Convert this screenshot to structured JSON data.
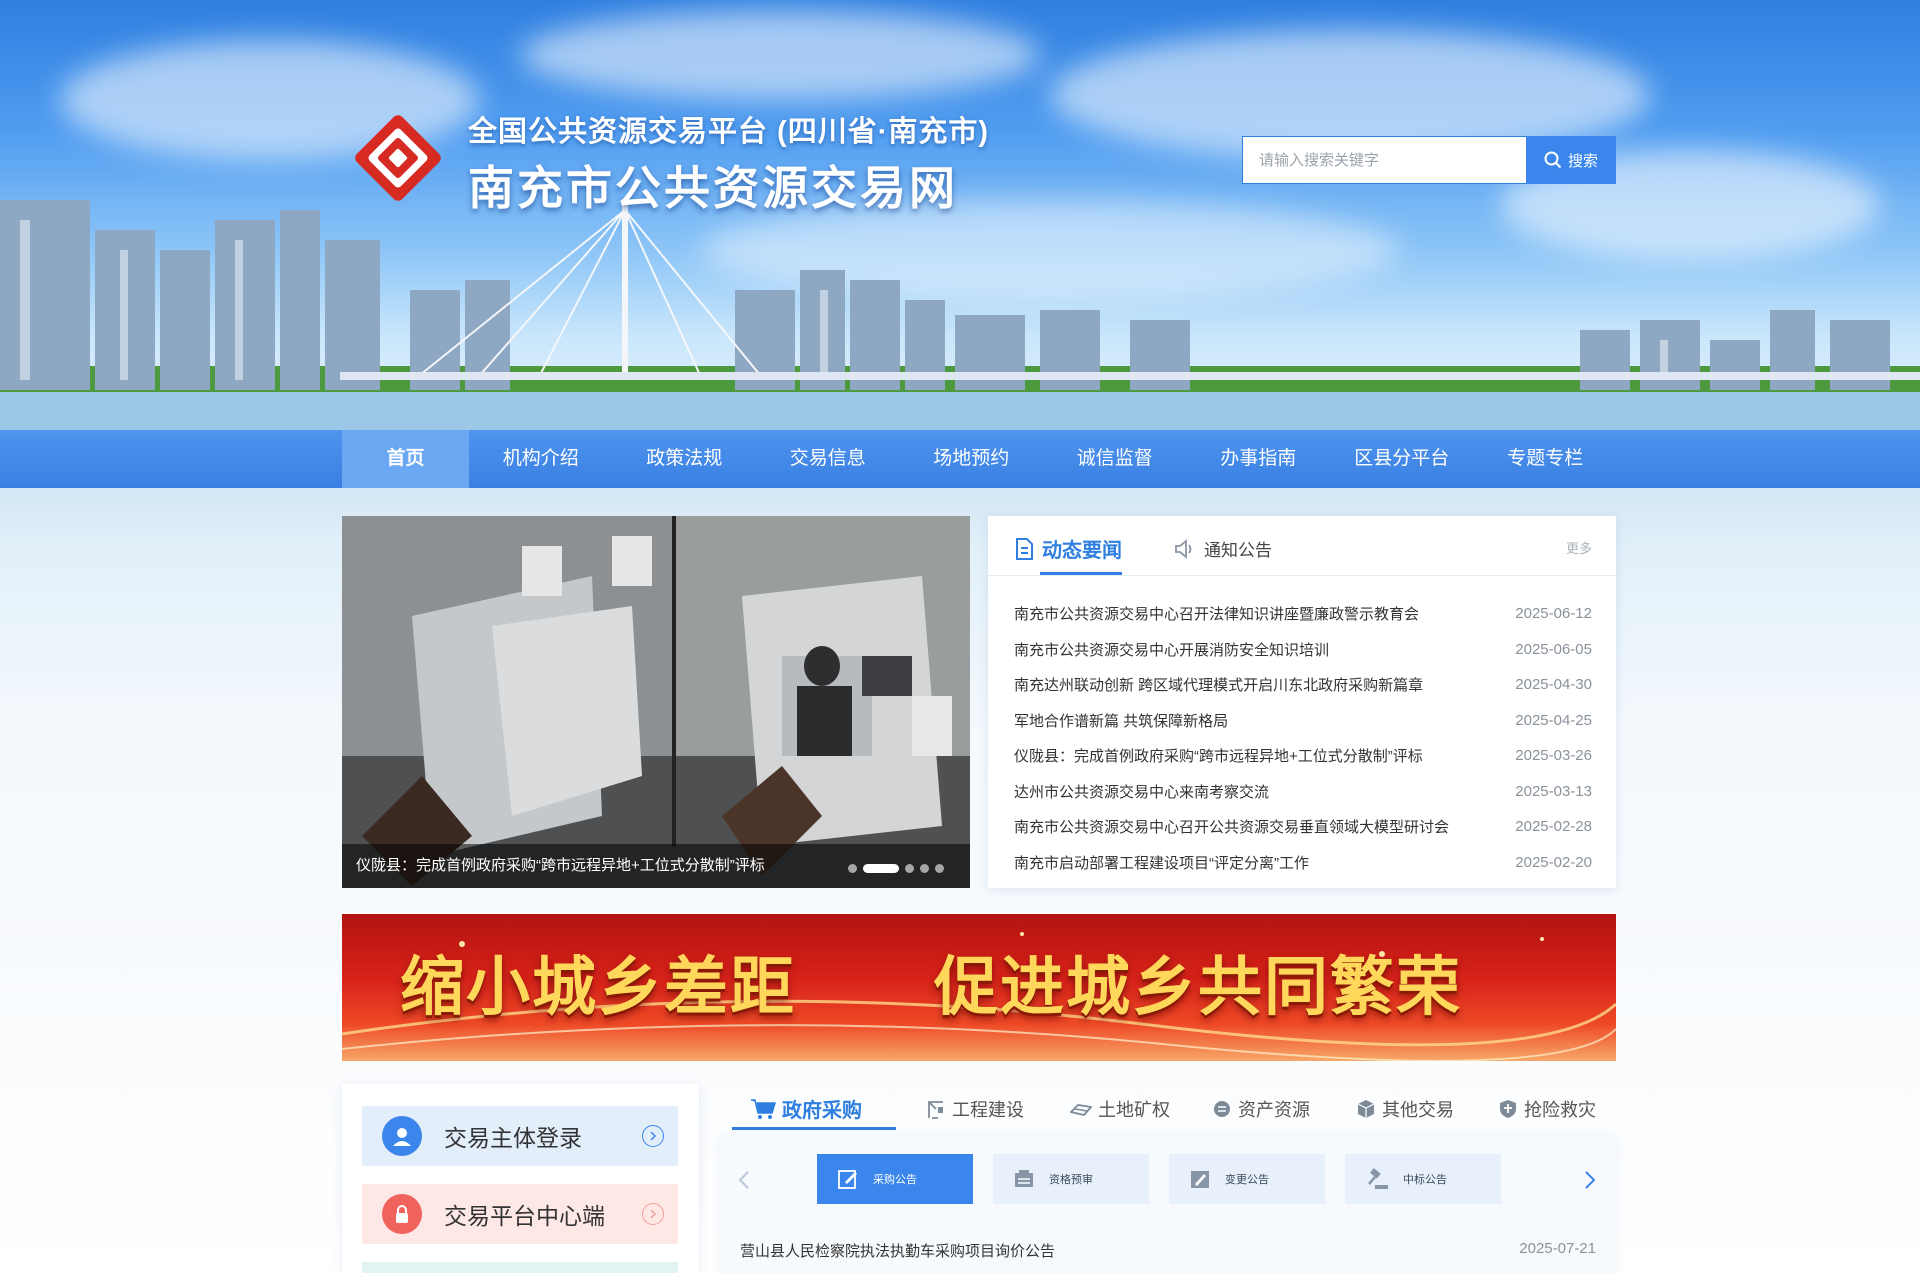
{
  "header": {
    "subtitle": "全国公共资源交易平台 (四川省·南充市)",
    "title": "南充市公共资源交易网",
    "search_placeholder": "请输入搜索关键字",
    "search_button": "搜索"
  },
  "nav": {
    "items": [
      "首页",
      "机构介绍",
      "政策法规",
      "交易信息",
      "场地预约",
      "诚信监督",
      "办事指南",
      "区县分平台",
      "专题专栏"
    ],
    "active_index": 0
  },
  "carousel": {
    "caption": "仪陇县：完成首例政府采购“跨市远程异地+工位式分散制”评标",
    "slide_count": 5,
    "active_slide": 2
  },
  "news": {
    "tab_active": "动态要闻",
    "tab_other": "通知公告",
    "more": "更多",
    "items": [
      {
        "title": "南充市公共资源交易中心召开法律知识讲座暨廉政警示教育会",
        "date": "2025-06-12"
      },
      {
        "title": "南充市公共资源交易中心开展消防安全知识培训",
        "date": "2025-06-05"
      },
      {
        "title": "南充达州联动创新 跨区域代理模式开启川东北政府采购新篇章",
        "date": "2025-04-30"
      },
      {
        "title": "军地合作谱新篇 共筑保障新格局",
        "date": "2025-04-25"
      },
      {
        "title": "仪陇县：完成首例政府采购“跨市远程异地+工位式分散制”评标",
        "date": "2025-03-26"
      },
      {
        "title": "达州市公共资源交易中心来南考察交流",
        "date": "2025-03-13"
      },
      {
        "title": "南充市公共资源交易中心召开公共资源交易垂直领域大模型研讨会",
        "date": "2025-02-28"
      },
      {
        "title": "南充市启动部署工程建设项目“评定分离”工作",
        "date": "2025-02-20"
      }
    ]
  },
  "banner": {
    "left_text": "缩小城乡差距",
    "right_text": "促进城乡共同繁荣"
  },
  "side": {
    "login_label": "交易主体登录",
    "center_label": "交易平台中心端"
  },
  "trade": {
    "tabs": [
      "政府采购",
      "工程建设",
      "土地矿权",
      "资产资源",
      "其他交易",
      "抢险救灾"
    ],
    "active_tab": 0,
    "subtabs": [
      "采购公告",
      "资格预审",
      "变更公告",
      "中标公告"
    ],
    "active_subtab": 0,
    "rows": [
      {
        "title": "营山县人民检察院执法执勤车采购项目询价公告",
        "date": "2025-07-21"
      }
    ]
  },
  "colors": {
    "primary": "#2f7fe0",
    "nav_bg": "#3a80e2",
    "banner_red": "#d8231a",
    "banner_gold": "#ffd75a"
  }
}
